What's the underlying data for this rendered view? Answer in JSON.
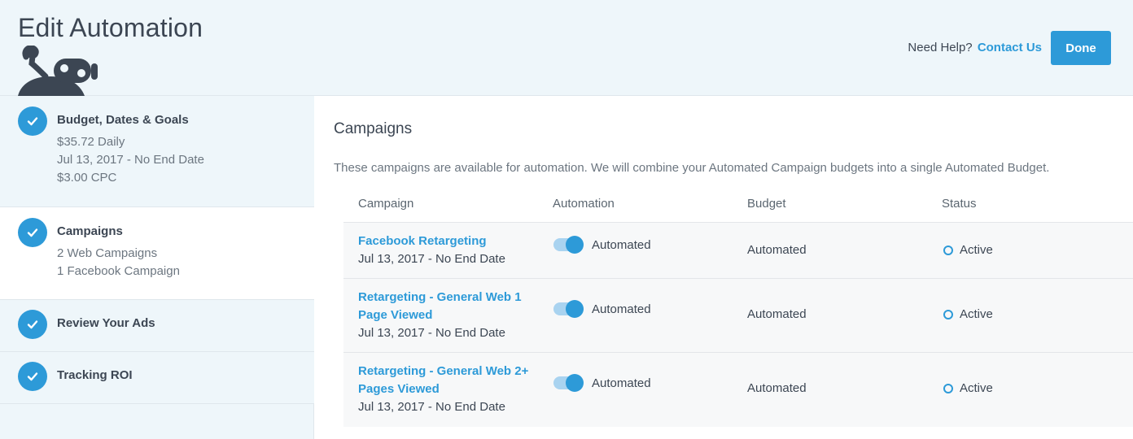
{
  "header": {
    "title": "Edit Automation",
    "help_text": "Need Help?",
    "contact_label": "Contact Us",
    "done_label": "Done"
  },
  "colors": {
    "accent": "#2d9ad8",
    "header_bg": "#eef6fa"
  },
  "sidebar": {
    "steps": [
      {
        "title": "Budget, Dates & Goals",
        "details": [
          "$35.72 Daily",
          "Jul 13, 2017 - No End Date",
          "$3.00 CPC"
        ]
      },
      {
        "title": "Campaigns",
        "details": [
          "2 Web Campaigns",
          "1 Facebook Campaign"
        ]
      },
      {
        "title": "Review Your Ads",
        "details": []
      },
      {
        "title": "Tracking ROI",
        "details": []
      }
    ]
  },
  "main": {
    "section_title": "Campaigns",
    "intro": "These campaigns are available for automation. We will combine your Automated Campaign budgets into a single Automated Budget.",
    "columns": [
      "Campaign",
      "Automation",
      "Budget",
      "Status"
    ],
    "rows": [
      {
        "name_line1": "Facebook Retargeting",
        "name_line2": "",
        "date": "Jul 13, 2017 - No End Date",
        "automation": "Automated",
        "budget": "Automated",
        "status": "Active"
      },
      {
        "name_line1": "Retargeting - General Web 1",
        "name_line2": "Page Viewed",
        "date": "Jul 13, 2017 - No End Date",
        "automation": "Automated",
        "budget": "Automated",
        "status": "Active"
      },
      {
        "name_line1": "Retargeting - General Web 2+",
        "name_line2": "Pages Viewed",
        "date": "Jul 13, 2017 - No End Date",
        "automation": "Automated",
        "budget": "Automated",
        "status": "Active"
      }
    ]
  }
}
